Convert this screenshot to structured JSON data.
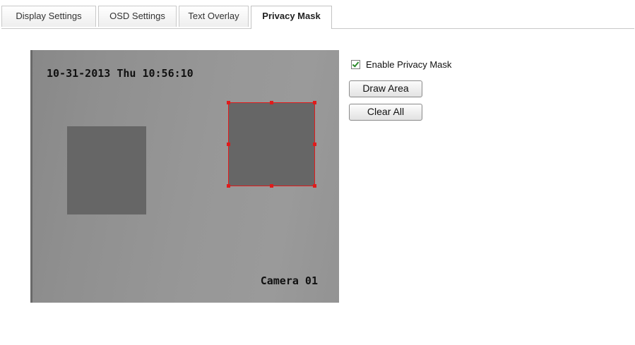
{
  "tabs": [
    {
      "label": "Display Settings",
      "active": false
    },
    {
      "label": "OSD Settings",
      "active": false
    },
    {
      "label": "Text Overlay",
      "active": false
    },
    {
      "label": "Privacy Mask",
      "active": true
    }
  ],
  "preview": {
    "date_time": "10-31-2013 Thu 10:56:10",
    "camera_name": "Camera 01",
    "mask_color": "#666666",
    "selection_color": "#e01b1b"
  },
  "controls": {
    "enable_label": "Enable Privacy Mask",
    "enable_checked": true,
    "draw_area_label": "Draw Area",
    "clear_all_label": "Clear All"
  }
}
